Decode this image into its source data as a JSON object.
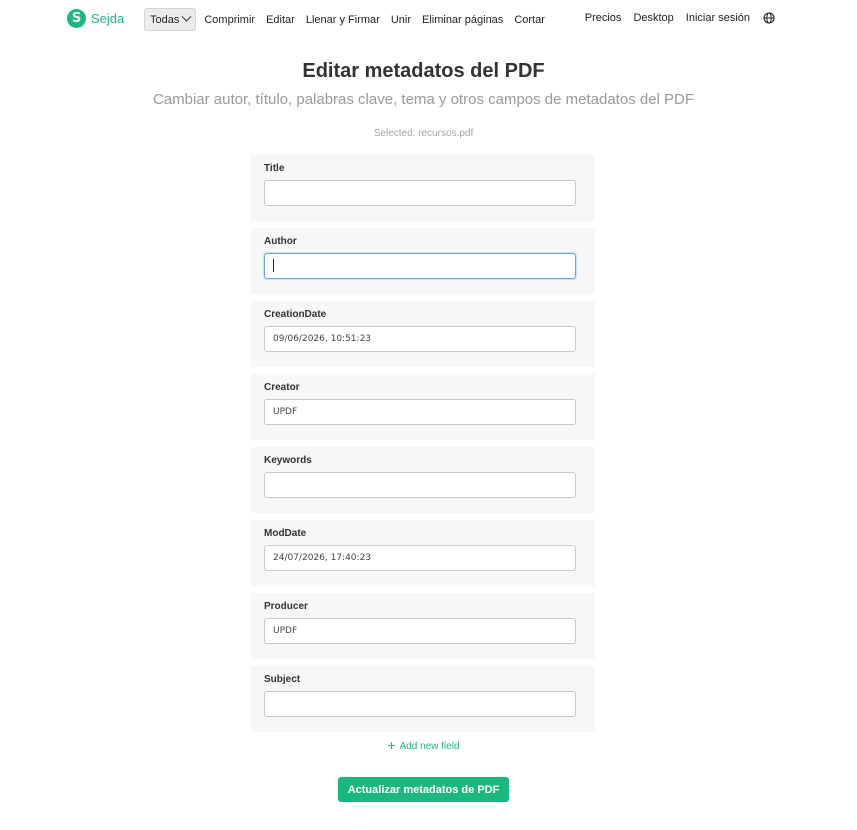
{
  "brand": {
    "logo_letter": "S",
    "name": "Sejda",
    "color": "#1bb87e"
  },
  "nav": {
    "dropdown_label": "Todas",
    "items": [
      "Comprimir",
      "Editar",
      "Llenar y Firmar",
      "Unir",
      "Eliminar páginas",
      "Cortar"
    ],
    "right_items": [
      "Precios",
      "Desktop",
      "Iniciar sesión"
    ],
    "language_icon": "globe-icon"
  },
  "header": {
    "title": "Editar metadatos del PDF",
    "subtitle": "Cambiar autor, título, palabras clave, tema y otros campos de metadatos del PDF",
    "selected": "Selected: recursos.pdf"
  },
  "fields": [
    {
      "label": "Title",
      "value": ""
    },
    {
      "label": "Author",
      "value": ""
    },
    {
      "label": "CreationDate",
      "value": "09/06/2026, 10:51:23"
    },
    {
      "label": "Creator",
      "value": "UPDF"
    },
    {
      "label": "Keywords",
      "value": ""
    },
    {
      "label": "ModDate",
      "value": "24/07/2026, 17:40:23"
    },
    {
      "label": "Producer",
      "value": "UPDF"
    },
    {
      "label": "Subject",
      "value": ""
    }
  ],
  "add_field": {
    "icon": "plus-icon",
    "label": "Add new field"
  },
  "submit_label": "Actualizar metadatos de PDF"
}
